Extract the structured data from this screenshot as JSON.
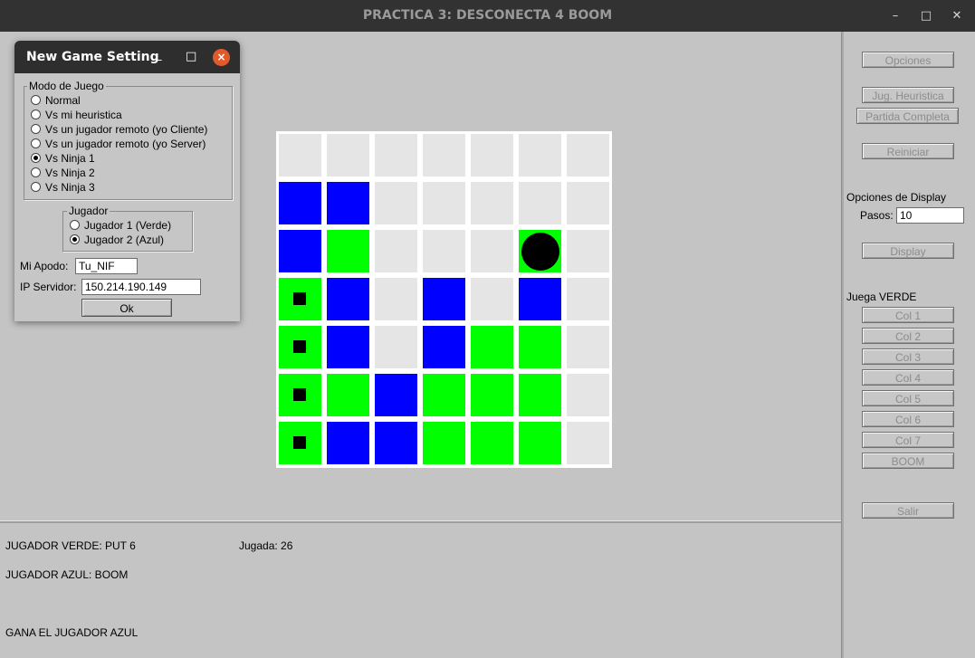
{
  "window": {
    "title": "PRACTICA 3: DESCONECTA 4 BOOM",
    "minimize_glyph": "–",
    "maximize_glyph": "□",
    "close_glyph": "✕"
  },
  "dialog": {
    "title": "New Game Setting",
    "minimize_glyph": "_",
    "maximize_glyph": "□",
    "close_glyph": "×",
    "modo_group": {
      "legend": "Modo de Juego",
      "options": [
        {
          "label": "Normal",
          "selected": false
        },
        {
          "label": "Vs mi heuristica",
          "selected": false
        },
        {
          "label": "Vs un jugador remoto (yo Cliente)",
          "selected": false
        },
        {
          "label": "Vs un jugador remoto (yo Server)",
          "selected": false
        },
        {
          "label": "Vs Ninja 1",
          "selected": true
        },
        {
          "label": "Vs Ninja 2",
          "selected": false
        },
        {
          "label": "Vs Ninja 3",
          "selected": false
        }
      ]
    },
    "jugador_group": {
      "legend": "Jugador",
      "options": [
        {
          "label": "Jugador 1 (Verde)",
          "selected": false
        },
        {
          "label": "Jugador 2 (Azul)",
          "selected": true
        }
      ]
    },
    "apodo_label": "Mi Apodo:",
    "apodo_value": "Tu_NIF",
    "ip_label": "IP Servidor:",
    "ip_value": "150.214.190.149",
    "ok_label": "Ok"
  },
  "board": {
    "rows": 7,
    "cols": 7,
    "colors": {
      "E": "#e5e5e5",
      "B": "#0000ff",
      "G": "#00ff00"
    },
    "cells": [
      [
        "E",
        "E",
        "E",
        "E",
        "E",
        "E",
        "E"
      ],
      [
        "B",
        "B",
        "E",
        "E",
        "E",
        "E",
        "E"
      ],
      [
        "B",
        "G",
        "E",
        "E",
        "E",
        "G",
        "E"
      ],
      [
        "G",
        "B",
        "E",
        "B",
        "E",
        "B",
        "E"
      ],
      [
        "G",
        "B",
        "E",
        "B",
        "G",
        "G",
        "E"
      ],
      [
        "G",
        "G",
        "B",
        "G",
        "G",
        "G",
        "E"
      ],
      [
        "G",
        "B",
        "B",
        "G",
        "G",
        "G",
        "E"
      ]
    ],
    "marks": [
      [
        3,
        0
      ],
      [
        4,
        0
      ],
      [
        5,
        0
      ],
      [
        6,
        0
      ]
    ],
    "disc": [
      2,
      5
    ]
  },
  "side": {
    "opciones": "Opciones",
    "jug_heuristica": "Jug. Heuristica",
    "partida_completa": "Partida Completa",
    "reiniciar": "Reiniciar",
    "display_options_label": "Opciones de Display",
    "pasos_label": "Pasos:",
    "pasos_value": "10",
    "display": "Display",
    "juega_label": "Juega VERDE",
    "columns": [
      "Col 1",
      "Col 2",
      "Col 3",
      "Col 4",
      "Col 5",
      "Col 6",
      "Col 7"
    ],
    "boom": "BOOM",
    "salir": "Salir"
  },
  "log": {
    "verde": "JUGADOR VERDE: PUT 6",
    "jugada": "Jugada: 26",
    "azul": "JUGADOR AZUL: BOOM",
    "result": "GANA EL JUGADOR AZUL"
  }
}
